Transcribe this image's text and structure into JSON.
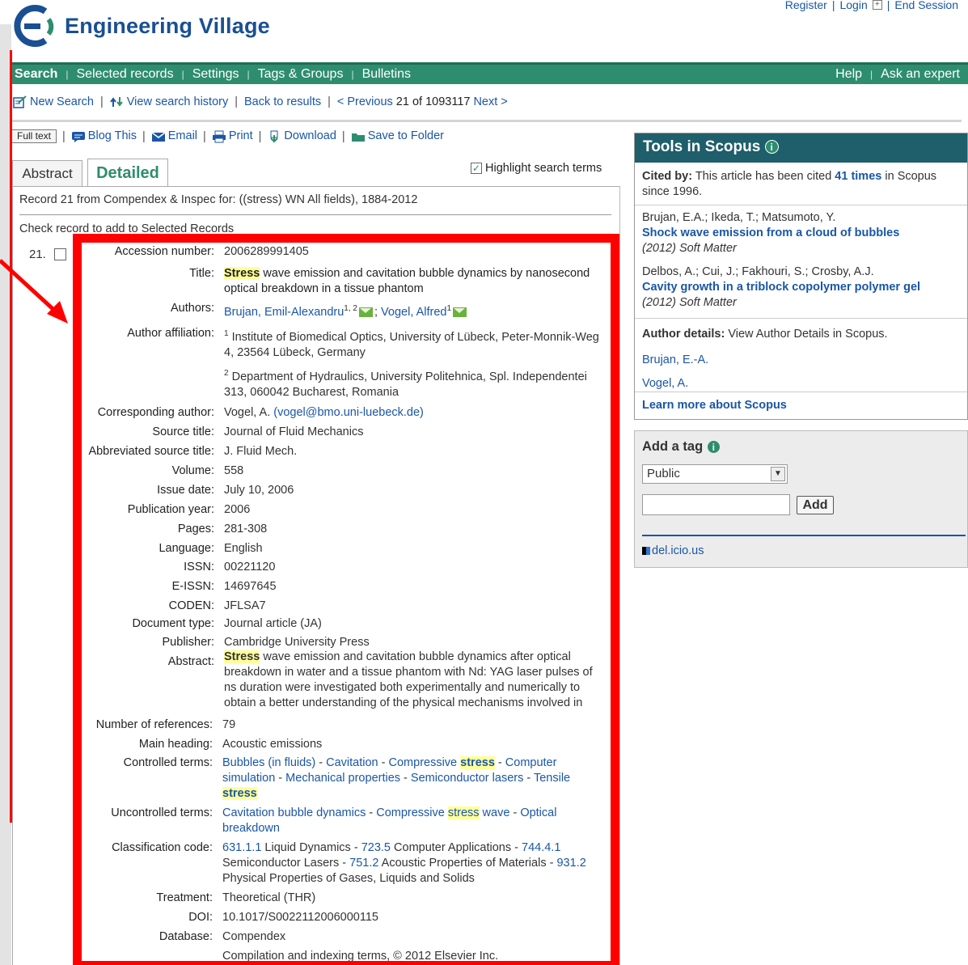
{
  "brand": {
    "name": "Engineering Village"
  },
  "top_links": [
    "Register",
    "Login",
    "End Session"
  ],
  "nav": {
    "left": [
      "Search",
      "Selected records",
      "Settings",
      "Tags & Groups",
      "Bulletins"
    ],
    "right": [
      "Help",
      "Ask an expert"
    ]
  },
  "subbar": {
    "new_search": "New Search",
    "view_history": "View search history",
    "back": "Back to results",
    "previous": "< Previous",
    "position": "21 of 1093117",
    "next": "Next >"
  },
  "actions": {
    "full_text": "Full text",
    "blog": "Blog This",
    "email": "Email",
    "print": "Print",
    "download": "Download",
    "save": "Save to Folder"
  },
  "tabs": {
    "abstract": "Abstract",
    "detailed": "Detailed"
  },
  "highlight_label": "Highlight search terms",
  "record_line": "Record 21 from Compendex & Inspec for: ((stress) WN All fields), 1884-2012",
  "check_line": "Check record to add to Selected Records",
  "record_number": "21.",
  "fields": {
    "accession": {
      "label": "Accession number:",
      "value": "2006289991405"
    },
    "title": {
      "label": "Title:",
      "hl": "Stress",
      "rest": " wave emission and cavitation bubble dynamics by nanosecond optical breakdown in a tissue phantom"
    },
    "authors": {
      "label": "Authors:",
      "a1": "Brujan, Emil-Alexandru",
      "a1_sup": "1, 2",
      "a2": "Vogel, Alfred",
      "a2_sup": "1",
      "sep": ";"
    },
    "affiliation": {
      "label": "Author affiliation:",
      "n1": "1",
      "t1": "Institute of Biomedical Optics, University of Lübeck, Peter-Monnik-Weg 4, 23564 Lübeck, Germany",
      "n2": "2",
      "t2": "Department of Hydraulics, University Politehnica, Spl. Independentei 313, 060042 Bucharest, Romania"
    },
    "corresponding": {
      "label": "Corresponding author:",
      "name": "Vogel, A.",
      "email": "(vogel@bmo.uni-luebeck.de)"
    },
    "source_title": {
      "label": "Source title:",
      "value": "Journal of Fluid Mechanics"
    },
    "abbrev": {
      "label": "Abbreviated source title:",
      "value": "J. Fluid Mech."
    },
    "volume": {
      "label": "Volume:",
      "value": "558"
    },
    "issue_date": {
      "label": "Issue date:",
      "value": "July 10, 2006"
    },
    "pub_year": {
      "label": "Publication year:",
      "value": "2006"
    },
    "pages": {
      "label": "Pages:",
      "value": "281-308"
    },
    "language": {
      "label": "Language:",
      "value": "English"
    },
    "issn": {
      "label": "ISSN:",
      "value": "00221120"
    },
    "eissn": {
      "label": "E-ISSN:",
      "value": "14697645"
    },
    "coden": {
      "label": "CODEN:",
      "value": "JFLSA7"
    },
    "doc_type": {
      "label": "Document type:",
      "value": "Journal article (JA)"
    },
    "publisher": {
      "label": "Publisher:",
      "value": "Cambridge University Press"
    },
    "abstract": {
      "label": "Abstract:",
      "hl": "Stress",
      "rest": " wave emission and cavitation bubble dynamics after optical breakdown in water and a tissue phantom with Nd: YAG laser pulses of ns duration were investigated both experimentally and numerically to obtain a better understanding of the physical mechanisms involved in"
    },
    "num_refs": {
      "label": "Number of references:",
      "value": "79"
    },
    "main_heading": {
      "label": "Main heading:",
      "value": "Acoustic emissions"
    },
    "controlled": {
      "label": "Controlled terms:",
      "t1": "Bubbles (in fluids)",
      "t2": "Cavitation",
      "t3a": "Compressive ",
      "t3b": "stress",
      "t4": "Computer simulation",
      "t5": "Mechanical properties",
      "t6": "Semiconductor lasers",
      "t7a": "Tensile ",
      "t7b": "stress",
      "dash": " - "
    },
    "uncontrolled": {
      "label": "Uncontrolled terms:",
      "t1": "Cavitation bubble dynamics",
      "t2a": "Compressive ",
      "t2b": "stress",
      "t2c": " wave",
      "t3": "Optical breakdown",
      "dash": " - "
    },
    "classification": {
      "label": "Classification code:",
      "c1": "631.1.1",
      "d1": " Liquid Dynamics",
      "c2": "723.5",
      "d2": " Computer Applications",
      "c3": "744.4.1",
      "d3": " Semiconductor Lasers",
      "c4": "751.2",
      "d4": " Acoustic Properties of Materials",
      "c5": "931.2",
      "d5": " Physical Properties of Gases, Liquids and Solids",
      "dash": " - "
    },
    "treatment": {
      "label": "Treatment:",
      "value": "Theoretical (THR)"
    },
    "doi": {
      "label": "DOI:",
      "value": "10.1017/S0022112006000115"
    },
    "database": {
      "label": "Database:",
      "value": "Compendex"
    },
    "copyright": {
      "value": "Compilation and indexing terms, © 2012 Elsevier Inc."
    }
  },
  "scopus": {
    "title": "Tools in Scopus",
    "cited_label": "Cited by:",
    "cited_pre": "This article has been cited",
    "cited_count": "41 times",
    "cited_post": "in Scopus since 1996.",
    "items": [
      {
        "authors": "Brujan, E.A.; Ikeda, T.; Matsumoto, Y.",
        "title": "Shock wave emission from a cloud of bubbles",
        "source": "(2012) Soft Matter"
      },
      {
        "authors": "Delbos, A.; Cui, J.; Fakhouri, S.; Crosby, A.J.",
        "title": "Cavity growth in a triblock copolymer polymer gel",
        "source": "(2012) Soft Matter"
      }
    ],
    "author_details_label": "Author details:",
    "author_details_text": "View Author Details in Scopus.",
    "author_links": [
      "Brujan, E.-A.",
      "Vogel, A."
    ],
    "learn_more": "Learn more about Scopus"
  },
  "tag": {
    "title": "Add a tag",
    "select_value": "Public",
    "add_label": "Add",
    "delicious": "del.icio.us"
  },
  "colors": {
    "nav_green": "#2e8d6e",
    "scopus_header": "#1f5e6b",
    "link_blue": "#1a56a6",
    "annotation_red": "#ff0000",
    "highlight_yellow": "#ffff99"
  }
}
